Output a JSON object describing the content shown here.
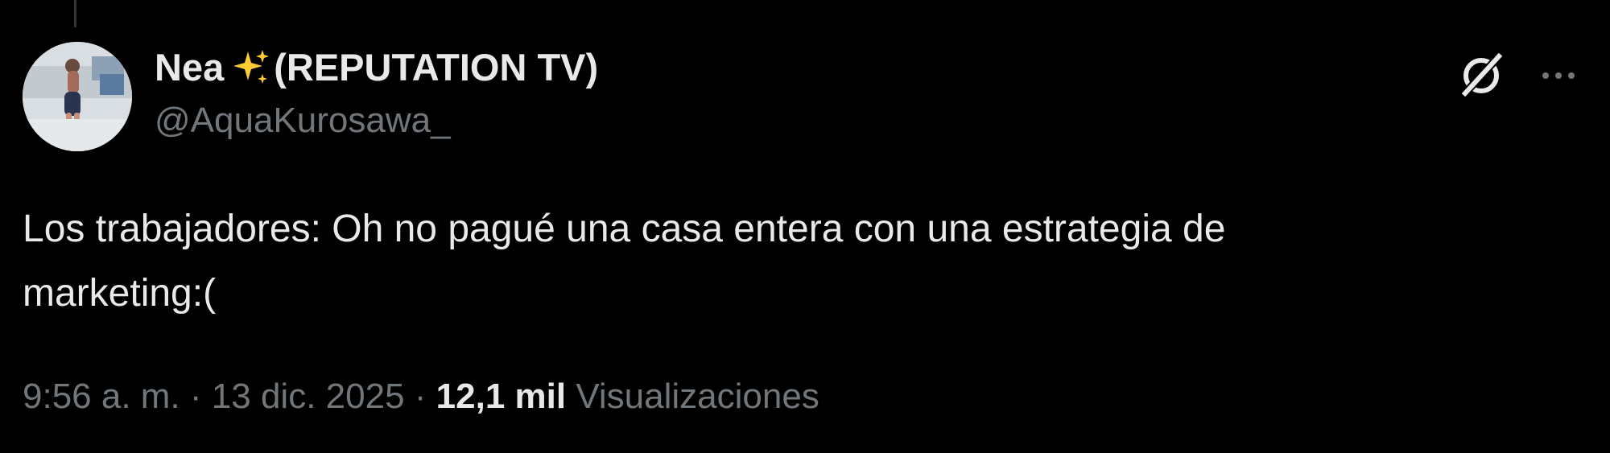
{
  "tweet": {
    "author": {
      "name_prefix": "Nea",
      "name_emoji_icon": "sparkles-icon",
      "name_suffix": "(REPUTATION TV)",
      "handle": "@AquaKurosawa_"
    },
    "text_line1": "Los trabajadores: Oh no pagué una casa entera con una estrategia de",
    "text_line2": "marketing:(",
    "time": "9:56 a. m.",
    "separator": "·",
    "date": "13 dic. 2025",
    "views_count": "12,1 mil",
    "views_label": "Visualizaciones"
  },
  "colors": {
    "background": "#000000",
    "text_primary": "#e7e9ea",
    "text_secondary": "#71767b",
    "sparkle": "#ffcc33"
  }
}
